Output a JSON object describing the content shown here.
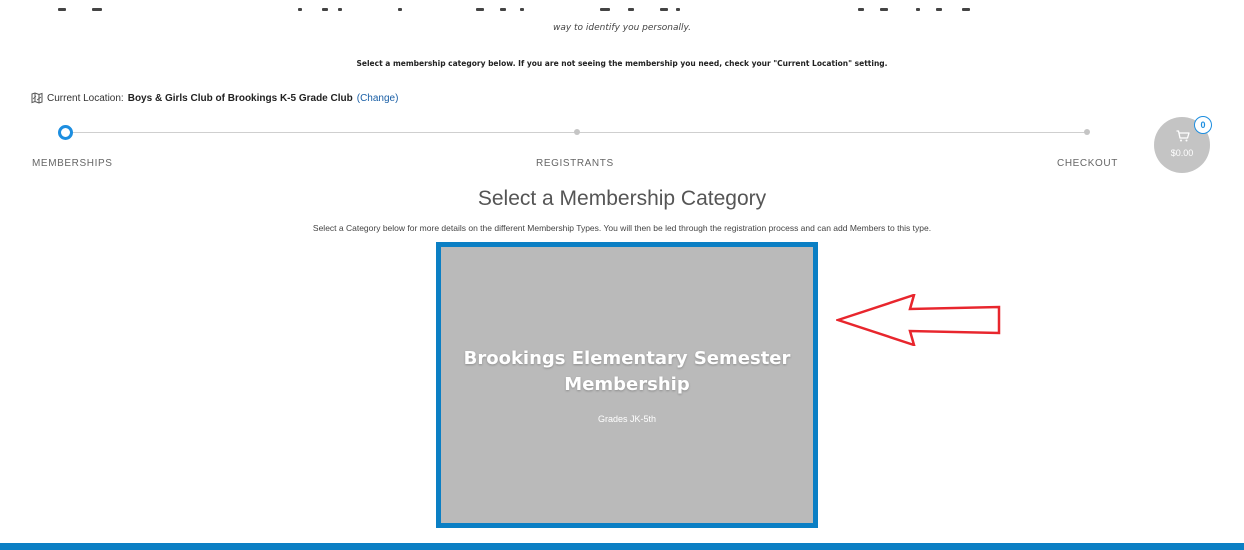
{
  "intro": {
    "italic_text": "way to identify you personally."
  },
  "notice": {
    "text": "Select a membership category below. If you are not seeing the membership you need, check your \"Current Location\" setting."
  },
  "location": {
    "icon": "map-icon",
    "label": "Current Location:",
    "name": "Boys & Girls Club of Brookings K-5 Grade Club",
    "change_label": "(Change)"
  },
  "steps": [
    {
      "label": "MEMBERSHIPS",
      "state": "active"
    },
    {
      "label": "REGISTRANTS",
      "state": "upcoming"
    },
    {
      "label": "CHECKOUT",
      "state": "upcoming"
    }
  ],
  "cart": {
    "icon": "shopping-cart-icon",
    "count": "0",
    "total": "$0.00"
  },
  "main": {
    "heading": "Select a Membership Category",
    "subtext": "Select a Category below for more details on the different Membership Types. You will then be led through the registration process and can add Members to this type."
  },
  "categories": [
    {
      "title": "Brookings Elementary Semester Membership",
      "subtitle": "Grades JK-5th"
    }
  ],
  "colors": {
    "accent": "#1d8ee0",
    "card_border": "#0b7fc4",
    "card_background": "#bababa",
    "annotation_arrow": "#e8262d"
  }
}
